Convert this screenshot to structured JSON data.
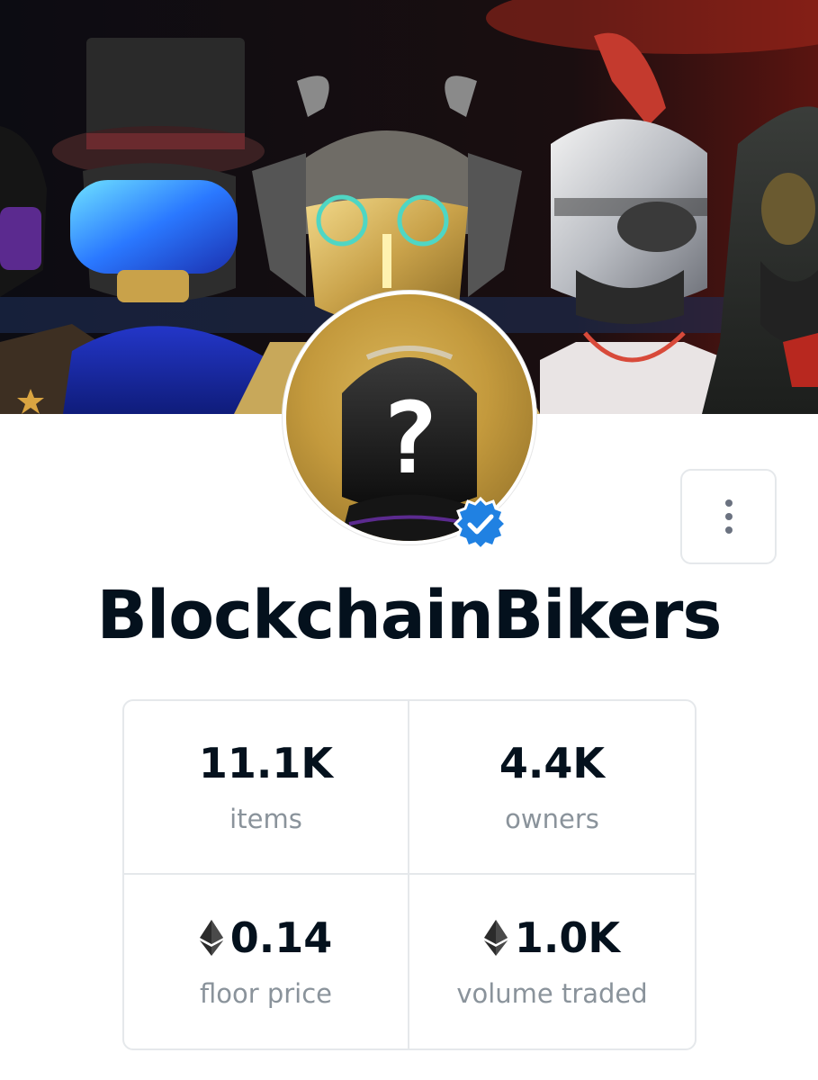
{
  "collection": {
    "name": "BlockchainBikers",
    "verified": true,
    "avatar_glyph": "?"
  },
  "menu": {
    "icon": "more-vertical-icon"
  },
  "stats": [
    {
      "value": "11.1K",
      "label": "items",
      "icon": null
    },
    {
      "value": "4.4K",
      "label": "owners",
      "icon": null
    },
    {
      "value": "0.14",
      "label": "floor price",
      "icon": "ethereum-icon"
    },
    {
      "value": "1.0K",
      "label": "volume traded",
      "icon": "ethereum-icon"
    }
  ],
  "colors": {
    "title": "#04111d",
    "label": "#8a939b",
    "border": "#e5e8eb",
    "verified_badge": "#2081e2",
    "avatar_background": "#c49a3d"
  }
}
